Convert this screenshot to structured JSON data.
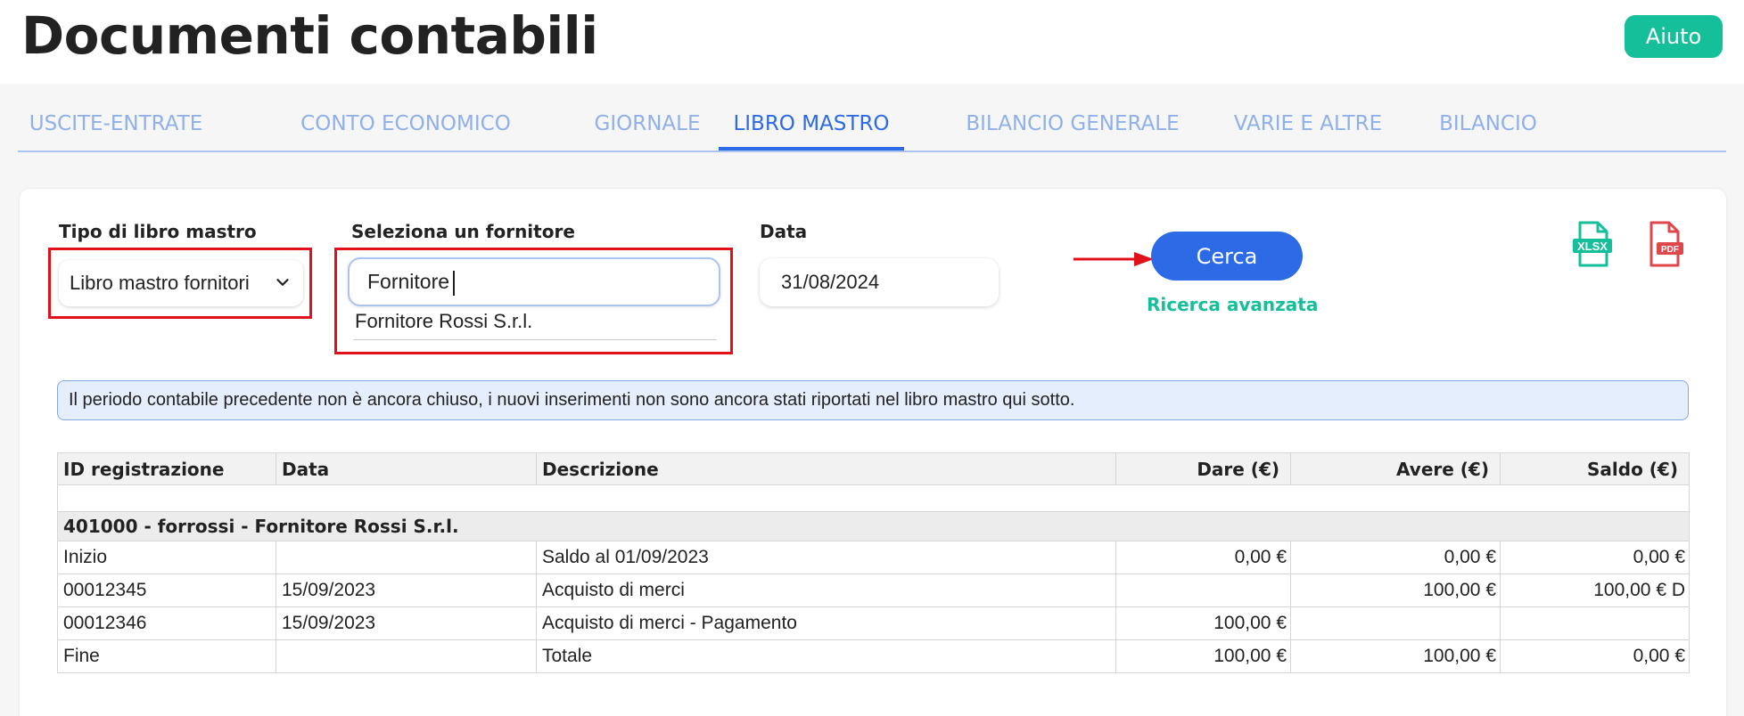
{
  "header": {
    "title": "Documenti contabili",
    "help_label": "Aiuto"
  },
  "tabs": [
    {
      "label": "USCITE-ENTRATE",
      "active": false
    },
    {
      "label": "CONTO ECONOMICO",
      "active": false
    },
    {
      "label": "GIORNALE",
      "active": false
    },
    {
      "label": "LIBRO MASTRO",
      "active": true
    },
    {
      "label": "BILANCIO GENERALE",
      "active": false
    },
    {
      "label": "VARIE E ALTRE",
      "active": false
    },
    {
      "label": "BILANCIO",
      "active": false
    }
  ],
  "filters": {
    "ledger_type_label": "Tipo di libro mastro",
    "ledger_type_value": "Libro mastro fornitori",
    "supplier_label": "Seleziona un fornitore",
    "supplier_value": "Fornitore",
    "supplier_suggestion": "Fornitore Rossi S.r.l.",
    "date_label": "Data",
    "date_value": "31/08/2024",
    "search_label": "Cerca",
    "advanced_search_label": "Ricerca avanzata"
  },
  "exports": {
    "xlsx_label": "XLSX",
    "pdf_label": "PDF",
    "xlsx_color": "#14bf9a",
    "pdf_color": "#e0474c"
  },
  "notice": "Il periodo contabile precedente non è ancora chiuso, i nuovi inserimenti non sono ancora stati riportati nel libro mastro qui sotto.",
  "table": {
    "columns": [
      "ID registrazione",
      "Data",
      "Descrizione",
      "Dare (€)",
      "Avere (€)",
      "Saldo (€)"
    ],
    "group_title": "401000 - forrossi - Fornitore Rossi S.r.l.",
    "rows": [
      {
        "id": "Inizio",
        "date": "",
        "description": "Saldo al 01/09/2023",
        "dare": "0,00 €",
        "avere": "0,00 €",
        "saldo": "0,00 €"
      },
      {
        "id": "00012345",
        "date": "15/09/2023",
        "description": "Acquisto di merci",
        "dare": "",
        "avere": "100,00 €",
        "saldo": "100,00 € D"
      },
      {
        "id": "00012346",
        "date": "15/09/2023",
        "description": "Acquisto di merci - Pagamento",
        "dare": "100,00 €",
        "avere": "",
        "saldo": ""
      },
      {
        "id": "Fine",
        "date": "",
        "description": "Totale",
        "dare": "100,00 €",
        "avere": "100,00 €",
        "saldo": "0,00 €"
      }
    ]
  },
  "colors": {
    "accent": "#2c6ae6",
    "tab_inactive": "#8fb0e9",
    "success": "#14bf9a",
    "highlight": "#e0111b"
  }
}
